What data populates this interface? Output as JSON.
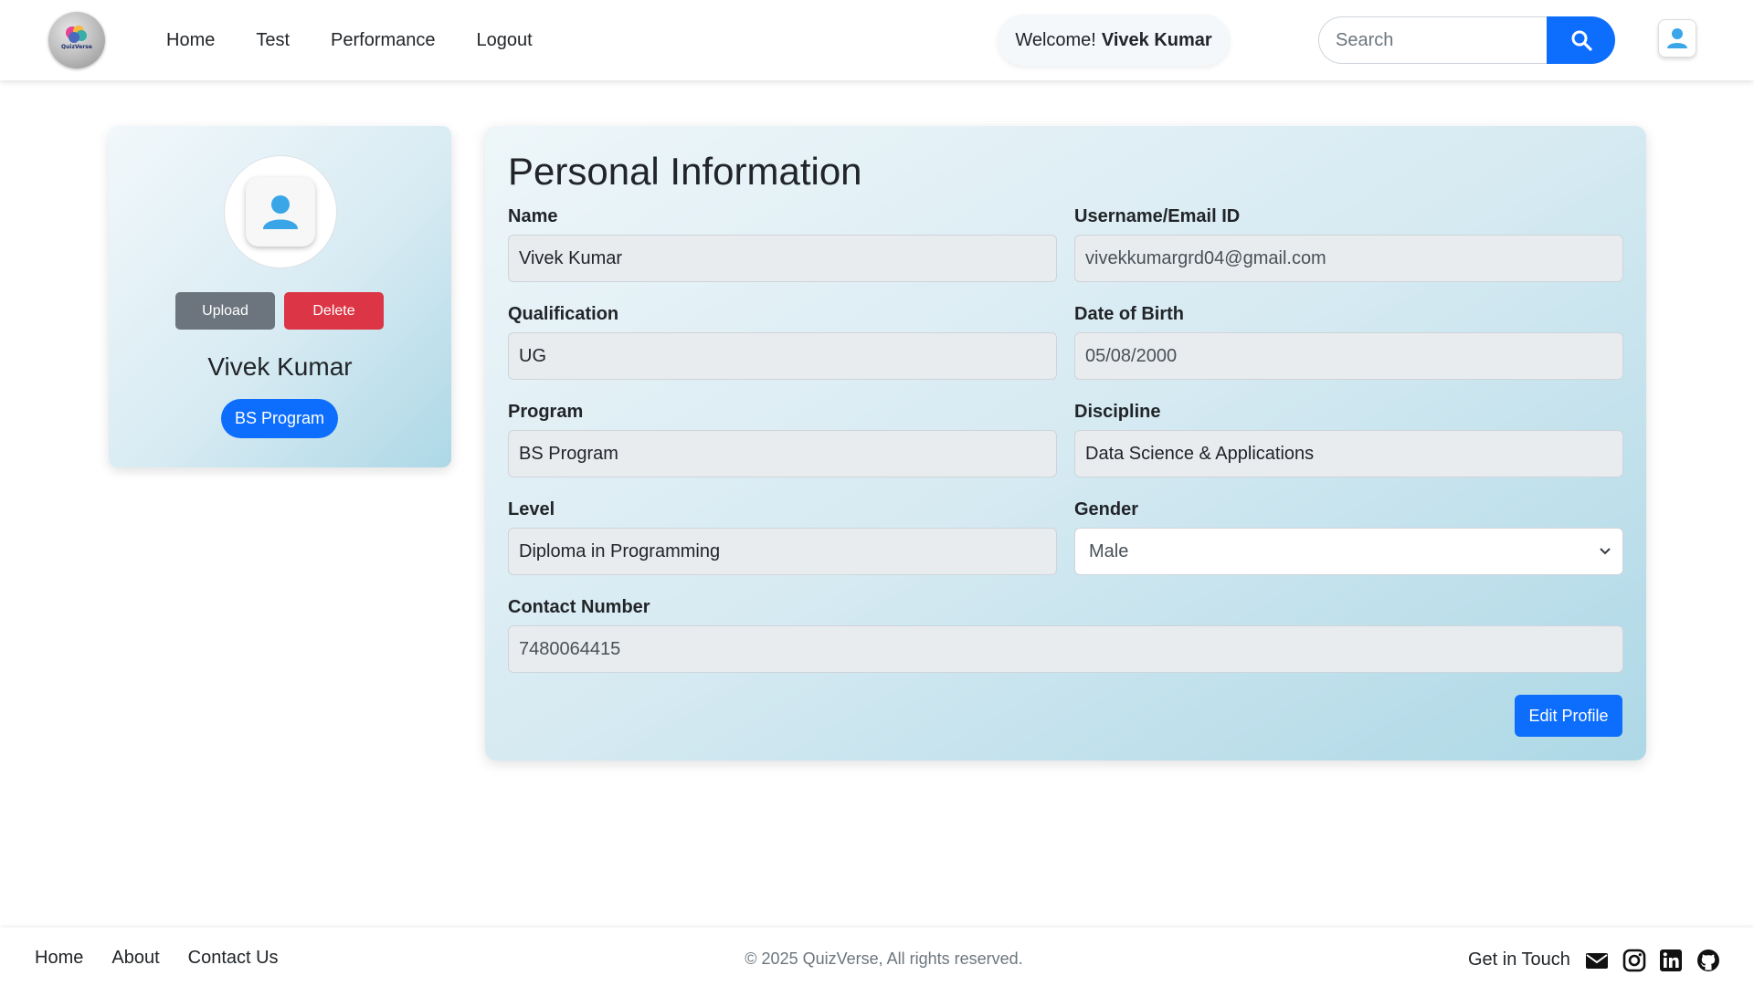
{
  "brand": {
    "logo_text": "QuizVerse"
  },
  "nav": {
    "links": [
      "Home",
      "Test",
      "Performance",
      "Logout"
    ],
    "welcome_prefix": "Welcome!",
    "welcome_user": "Vivek Kumar",
    "search_placeholder": "Search",
    "search_icon": "search-icon",
    "user_icon": "user-icon"
  },
  "profile": {
    "avatar_icon": "user-avatar-icon",
    "upload_label": "Upload",
    "delete_label": "Delete",
    "name": "Vivek Kumar",
    "program_badge": "BS Program"
  },
  "info": {
    "title": "Personal Information",
    "fields": {
      "name": {
        "label": "Name",
        "value": "Vivek Kumar"
      },
      "email": {
        "label": "Username/Email ID",
        "value": "vivekkumargrd04@gmail.com"
      },
      "qualification": {
        "label": "Qualification",
        "value": "UG"
      },
      "dob": {
        "label": "Date of Birth",
        "value": "05/08/2000"
      },
      "program": {
        "label": "Program",
        "value": "BS Program"
      },
      "discipline": {
        "label": "Discipline",
        "value": "Data Science & Applications"
      },
      "level": {
        "label": "Level",
        "value": "Diploma in Programming"
      },
      "gender": {
        "label": "Gender",
        "value": "Male"
      },
      "contact": {
        "label": "Contact Number",
        "value": "7480064415"
      }
    },
    "edit_label": "Edit Profile"
  },
  "footer": {
    "links": [
      "Home",
      "About",
      "Contact Us"
    ],
    "copyright": "© 2025 QuizVerse, All rights reserved.",
    "get_in_touch": "Get in Touch",
    "social_icons": [
      "mail-icon",
      "instagram-icon",
      "linkedin-icon",
      "github-icon"
    ]
  },
  "colors": {
    "primary": "#0d6efd",
    "secondary": "#6c757d",
    "danger": "#dc3545",
    "card_gradient_end": "#add8e6"
  }
}
